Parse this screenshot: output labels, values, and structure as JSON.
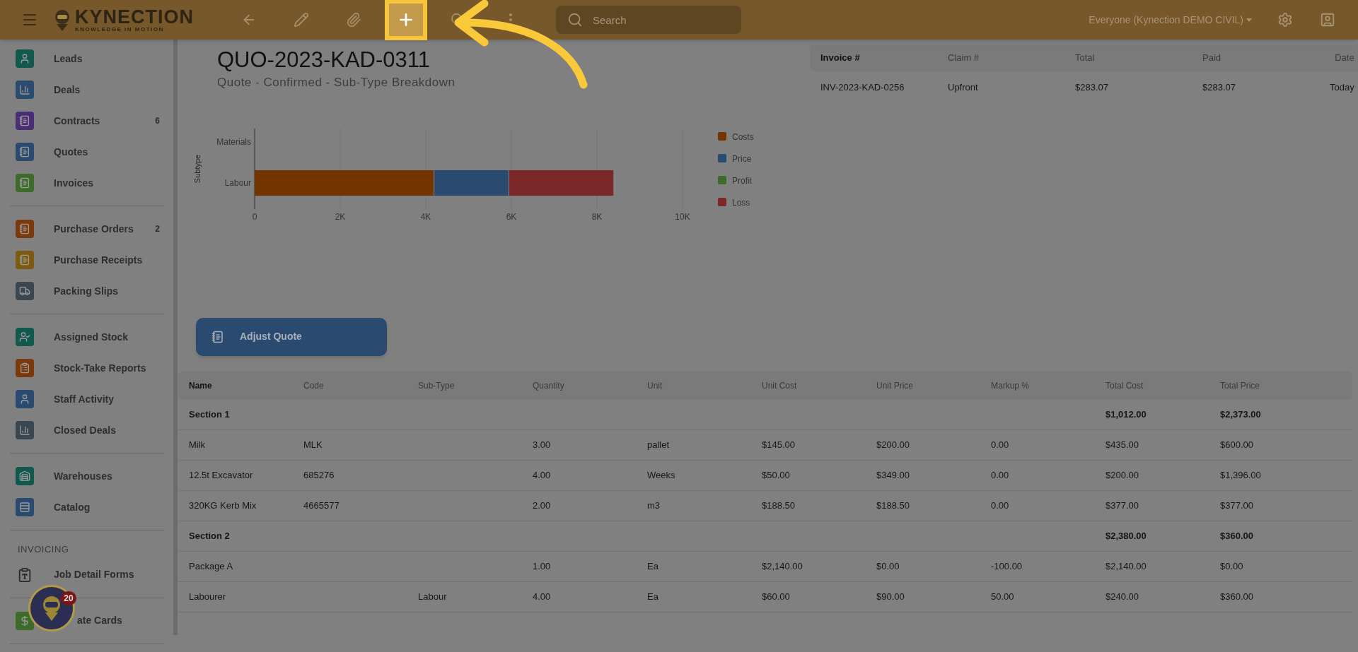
{
  "topbar": {
    "logo": {
      "title": "KYNECTION",
      "tagline": "KNOWLEDGE IN MOTION"
    },
    "tools": [
      {
        "kind": "back",
        "highlighted": false
      },
      {
        "kind": "edit",
        "highlighted": false
      },
      {
        "kind": "attach",
        "highlighted": false
      },
      {
        "kind": "add",
        "highlighted": true
      },
      {
        "kind": "cloud",
        "highlighted": false
      },
      {
        "kind": "more",
        "highlighted": false
      }
    ],
    "search": {
      "placeholder": "Search"
    },
    "account": "Everyone (Kynection DEMO CIVIL)"
  },
  "sidebar": {
    "groups": [
      {
        "items": [
          {
            "label": "Leads",
            "kind": "tile",
            "color": "#12584d"
          },
          {
            "label": "Deals",
            "kind": "tile",
            "color": "#2b4a70"
          },
          {
            "label": "Contracts",
            "count": "6",
            "kind": "tile",
            "color": "#4a2e75"
          },
          {
            "label": "Quotes",
            "kind": "tile",
            "color": "#2b4a70"
          },
          {
            "label": "Invoices",
            "kind": "tile",
            "color": "#3e6a2a"
          }
        ]
      },
      {
        "items": [
          {
            "label": "Purchase Orders",
            "count": "2",
            "kind": "tile",
            "color": "#7a3a0d"
          },
          {
            "label": "Purchase Receipts",
            "kind": "tile",
            "color": "#7d5a0d"
          },
          {
            "label": "Packing Slips",
            "kind": "tile",
            "color": "#3a4650"
          }
        ]
      },
      {
        "items": [
          {
            "label": "Assigned Stock",
            "kind": "tile",
            "color": "#12584d"
          },
          {
            "label": "Stock-Take Reports",
            "kind": "tile",
            "color": "#7a3a0d"
          },
          {
            "label": "Staff Activity",
            "kind": "tile",
            "color": "#2b4a70"
          },
          {
            "label": "Closed Deals",
            "kind": "tile",
            "color": "#3a4650"
          }
        ]
      },
      {
        "items": [
          {
            "label": "Warehouses",
            "kind": "tile",
            "color": "#12584d"
          },
          {
            "label": "Catalog",
            "kind": "tile",
            "color": "#2b4a70"
          }
        ]
      },
      {
        "header": "INVOICING",
        "items": [
          {
            "label": "Job Detail Forms",
            "kind": "plain"
          }
        ]
      },
      {
        "items": [
          {
            "label": "ate Cards",
            "kind": "tile",
            "color": "#3e6a2a"
          }
        ]
      }
    ]
  },
  "assistant": {
    "badge": "20"
  },
  "quote": {
    "title": "QUO-2023-KAD-0311",
    "subtitle": "Quote - Confirmed - Sub-Type Breakdown"
  },
  "chart": {
    "chart_data": {
      "type": "bar",
      "orientation": "horizontal",
      "stacked": true,
      "ylabel": "Subtype",
      "categories": [
        "Materials",
        "Labour"
      ],
      "series": [
        {
          "name": "Costs",
          "color": "#733500",
          "values": [
            0,
            4200
          ]
        },
        {
          "name": "Price",
          "color": "#2b4a70",
          "values": [
            0,
            1750
          ]
        },
        {
          "name": "Profit",
          "color": "#3e6a2a",
          "values": [
            0,
            0
          ]
        },
        {
          "name": "Loss",
          "color": "#7a2828",
          "values": [
            0,
            2450
          ]
        }
      ],
      "xlim": [
        0,
        10000
      ],
      "grid": true,
      "legend": true,
      "xticks": [
        {
          "value": 0,
          "label": "0"
        },
        {
          "value": 2000,
          "label": "2K"
        },
        {
          "value": 4000,
          "label": "4K"
        },
        {
          "value": 6000,
          "label": "6K"
        },
        {
          "value": 8000,
          "label": "8K"
        },
        {
          "value": 10000,
          "label": "10K"
        }
      ]
    }
  },
  "adjust_button": "Adjust Quote",
  "invoices": {
    "columns": [
      "Invoice #",
      "Claim #",
      "Total",
      "Paid",
      "Date"
    ],
    "rows": [
      [
        "INV-2023-KAD-0256",
        "Upfront",
        "$283.07",
        "$283.07",
        "Today"
      ]
    ]
  },
  "lines": {
    "columns": [
      "Name",
      "Code",
      "Sub-Type",
      "Quantity",
      "Unit",
      "Unit Cost",
      "Unit Price",
      "Markup %",
      "Total Cost",
      "Total Price"
    ],
    "rows": [
      {
        "kind": "section",
        "name": "Section 1",
        "total_cost": "$1,012.00",
        "total_price": "$2,373.00"
      },
      {
        "kind": "item",
        "name": "Milk",
        "code": "MLK",
        "quantity": "3.00",
        "unit": "pallet",
        "unit_cost": "$145.00",
        "unit_price": "$200.00",
        "markup": "0.00",
        "total_cost": "$435.00",
        "total_price": "$600.00"
      },
      {
        "kind": "item",
        "name": "12.5t Excavator",
        "code": "685276",
        "quantity": "4.00",
        "unit": "Weeks",
        "unit_cost": "$50.00",
        "unit_price": "$349.00",
        "markup": "0.00",
        "total_cost": "$200.00",
        "total_price": "$1,396.00"
      },
      {
        "kind": "item",
        "name": "320KG Kerb Mix",
        "code": "4665577",
        "quantity": "2.00",
        "unit": "m3",
        "unit_cost": "$188.50",
        "unit_price": "$188.50",
        "markup": "0.00",
        "total_cost": "$377.00",
        "total_price": "$377.00"
      },
      {
        "kind": "section",
        "name": "Section 2",
        "total_cost": "$2,380.00",
        "total_price": "$360.00"
      },
      {
        "kind": "item",
        "name": "Package A",
        "quantity": "1.00",
        "unit": "Ea",
        "unit_cost": "$2,140.00",
        "unit_price": "$0.00",
        "markup": "-100.00",
        "total_cost": "$2,140.00",
        "total_price": "$0.00"
      },
      {
        "kind": "item",
        "name": "Labourer",
        "subtype": "Labour",
        "quantity": "4.00",
        "unit": "Ea",
        "unit_cost": "$60.00",
        "unit_price": "$90.00",
        "markup": "50.00",
        "total_cost": "$240.00",
        "total_price": "$360.00"
      }
    ]
  }
}
